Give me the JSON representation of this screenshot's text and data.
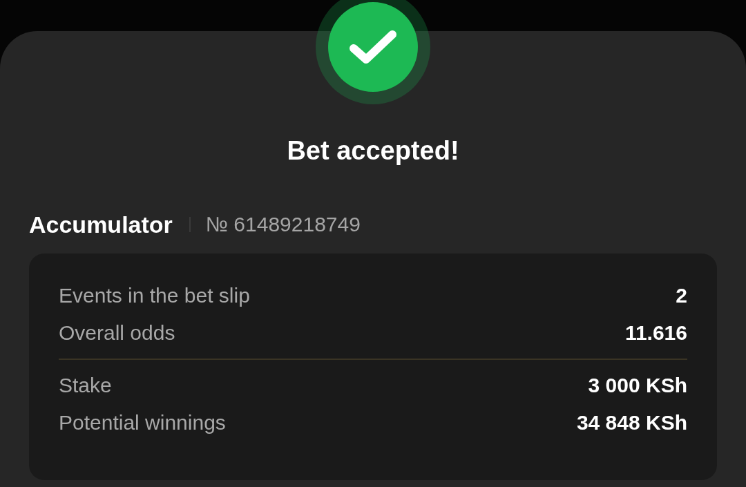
{
  "status": {
    "title": "Bet accepted!"
  },
  "bet": {
    "type": "Accumulator",
    "number": "№ 61489218749"
  },
  "summary_groups": [
    [
      {
        "label": "Events in the bet slip",
        "value": "2"
      },
      {
        "label": "Overall odds",
        "value": "11.616"
      }
    ],
    [
      {
        "label": "Stake",
        "value": "3 000 KSh"
      },
      {
        "label": "Potential winnings",
        "value": "34 848 KSh"
      }
    ]
  ]
}
